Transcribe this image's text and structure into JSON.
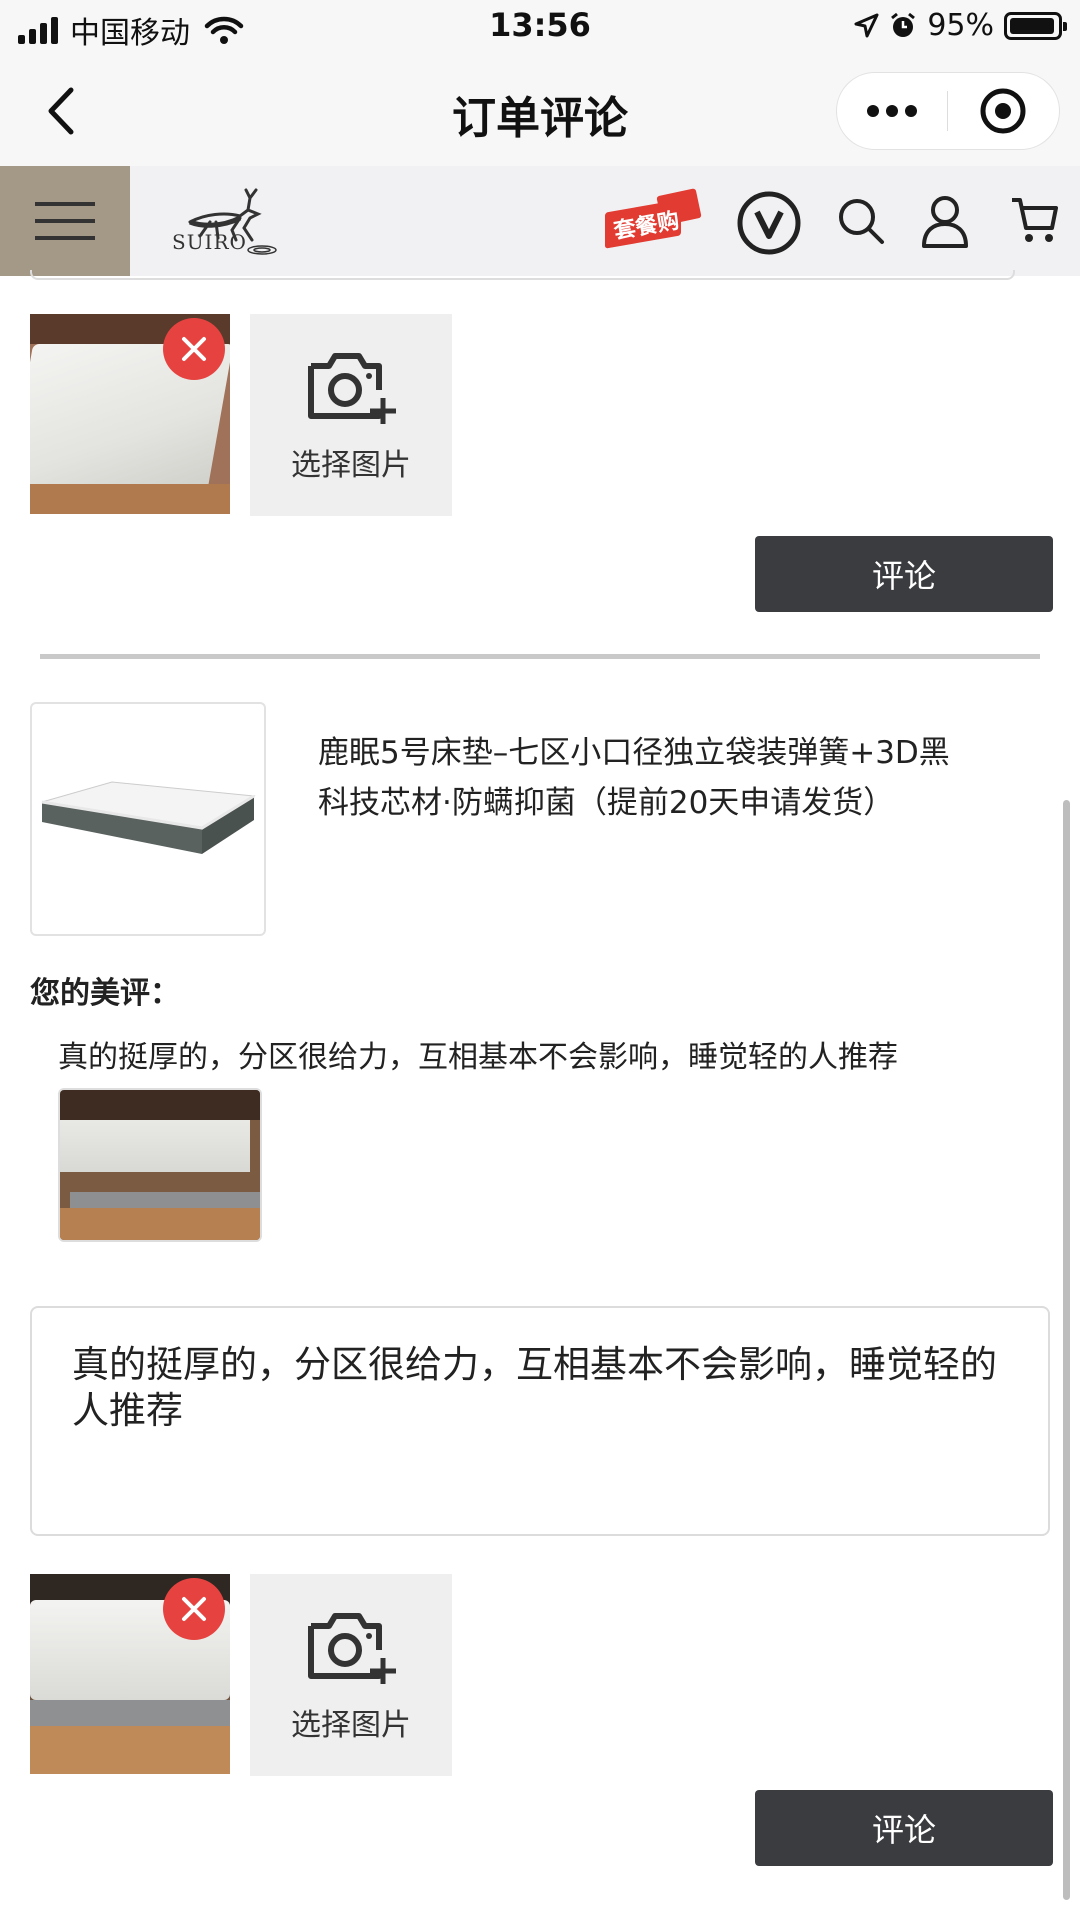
{
  "status_bar": {
    "carrier": "中国移动",
    "time": "13:56",
    "battery": "95%",
    "battery_level": 0.95
  },
  "nav": {
    "title": "订单评论"
  },
  "header": {
    "logo_text": "SUIRO",
    "package_badge": "套餐购"
  },
  "upload_section_1": {
    "choose_label": "选择图片",
    "submit_label": "评论"
  },
  "product": {
    "title": "鹿眠5号床垫–七区小口径独立袋装弹簧+3D黑科技芯材·防螨抑菌（提前20天申请发货）",
    "review_label": "您的美评：",
    "review_text": "真的挺厚的，分区很给力，互相基本不会影响，睡觉轻的人推荐"
  },
  "input": {
    "value": "真的挺厚的，分区很给力，互相基本不会影响，睡觉轻的人推荐"
  },
  "upload_section_2": {
    "choose_label": "选择图片",
    "submit_label": "评论"
  },
  "colors": {
    "menu_bg": "#a49987",
    "button_bg": "#3a3c3f",
    "remove_red": "#e64340",
    "badge_red": "#e23b31"
  }
}
